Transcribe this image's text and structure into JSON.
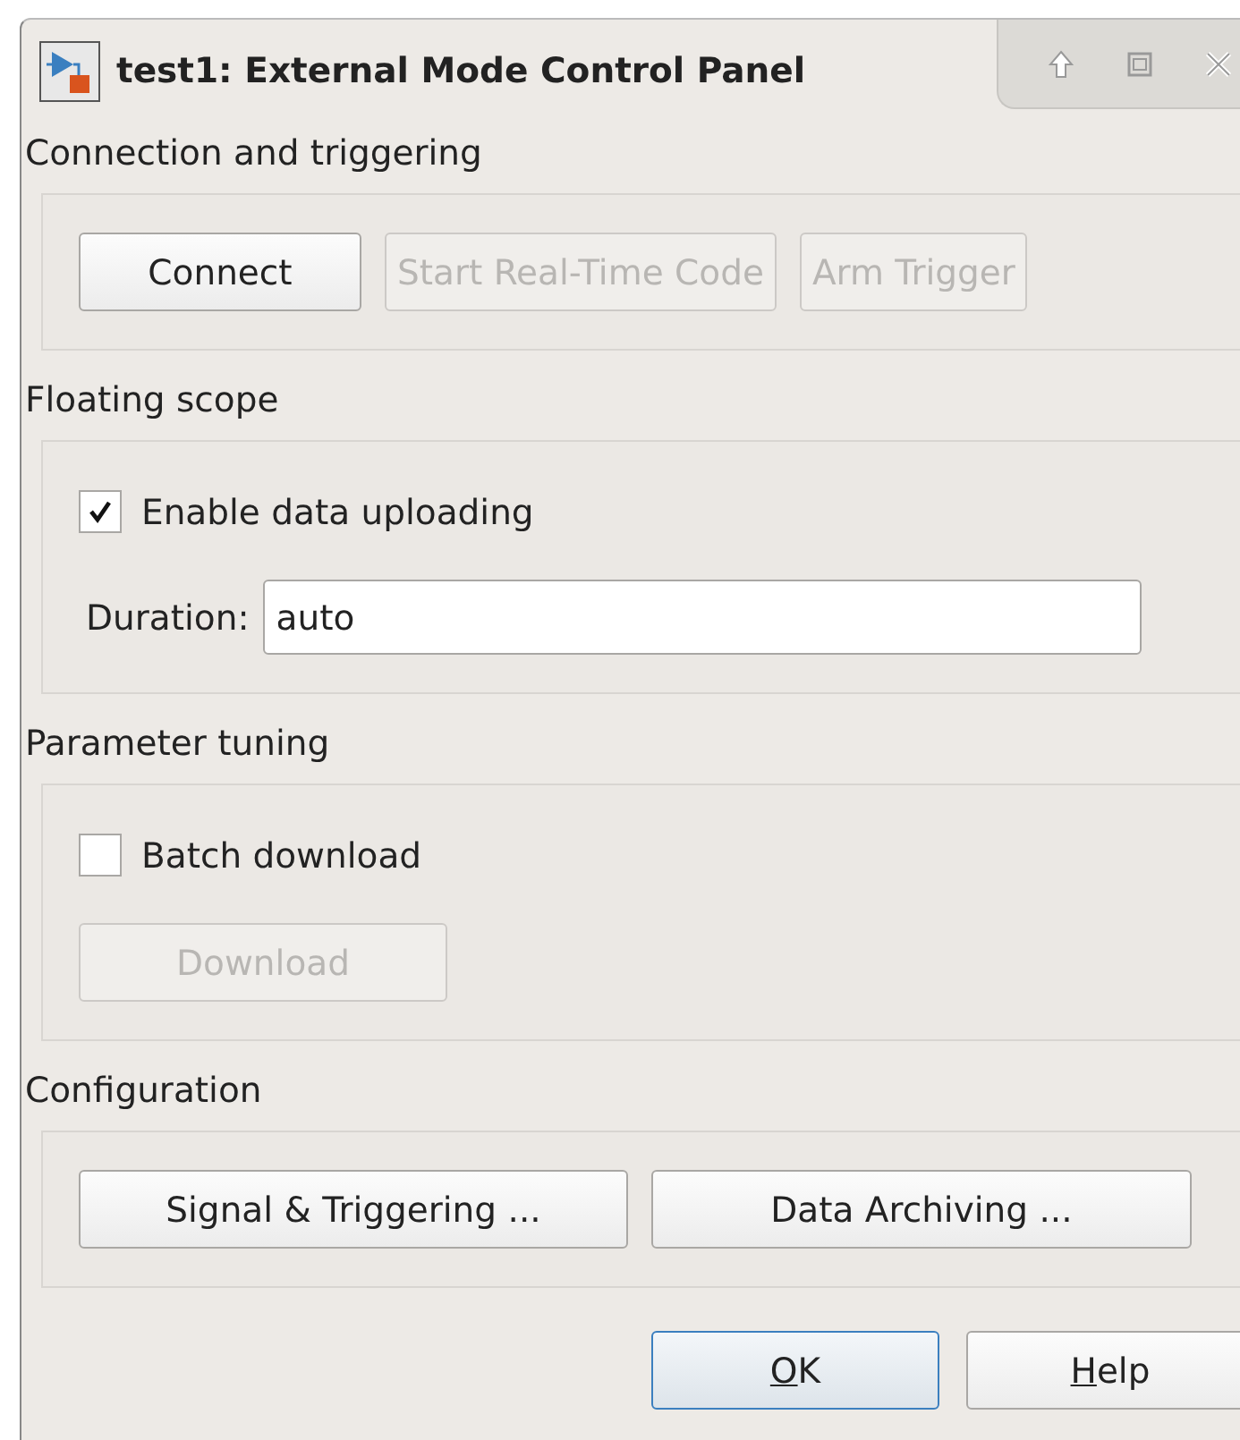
{
  "window": {
    "title": "test1: External Mode Control Panel"
  },
  "sections": [
    {
      "title": "Connection and triggering",
      "items": [
        {
          "kind": "buttons",
          "buttons": [
            {
              "label": "Connect",
              "disabled": false
            },
            {
              "label": "Start Real-Time Code",
              "disabled": true
            },
            {
              "label": "Arm Trigger",
              "disabled": true
            }
          ]
        }
      ]
    },
    {
      "title": "Floating scope",
      "items": [
        {
          "kind": "checkbox",
          "label": "Enable data uploading",
          "checked": true
        },
        {
          "kind": "field",
          "label": "Duration:",
          "value": "auto"
        }
      ]
    },
    {
      "title": "Parameter tuning",
      "items": [
        {
          "kind": "checkbox",
          "label": "Batch download",
          "checked": false
        },
        {
          "kind": "buttons",
          "buttons": [
            {
              "label": "Download",
              "disabled": true
            }
          ]
        }
      ]
    },
    {
      "title": "Configuration",
      "items": [
        {
          "kind": "button_pair",
          "buttons": [
            {
              "label": "Signal & Triggering ...",
              "disabled": false
            },
            {
              "label": "Data Archiving ...",
              "disabled": false
            }
          ]
        }
      ]
    }
  ],
  "dialog_buttons": [
    {
      "label": "OK",
      "default": true,
      "mnemonic_first": true
    },
    {
      "label": "Help",
      "default": false,
      "mnemonic_first": true
    }
  ]
}
